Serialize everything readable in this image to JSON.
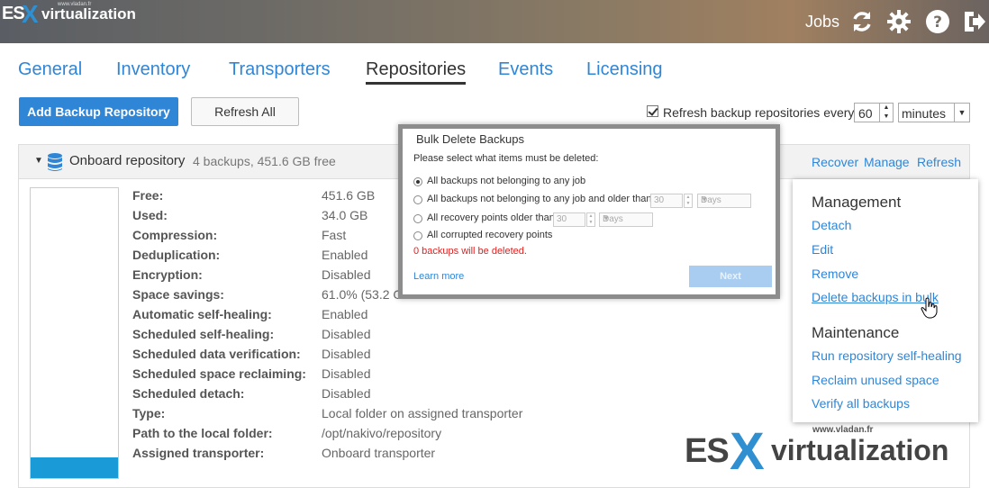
{
  "brand": {
    "es": "ES",
    "x": "X",
    "rest": "virtualization",
    "url": "www.vladan.fr"
  },
  "header": {
    "jobs": "Jobs"
  },
  "icons": {
    "refresh": "refresh-icon",
    "settings": "gear-icon",
    "help": "help-icon",
    "logout": "logout-icon"
  },
  "tabs": [
    {
      "label": "General"
    },
    {
      "label": "Inventory"
    },
    {
      "label": "Transporters"
    },
    {
      "label": "Repositories",
      "active": true
    },
    {
      "label": "Events"
    },
    {
      "label": "Licensing"
    }
  ],
  "toolbar": {
    "add": "Add Backup Repository",
    "refresh_all": "Refresh All",
    "auto_refresh_label": "Refresh backup repositories every",
    "auto_refresh_checked": true,
    "interval": "60",
    "unit": "minutes"
  },
  "repository": {
    "name": "Onboard repository",
    "summary": "4 backups, 451.6 GB free",
    "actions": {
      "recover": "Recover",
      "manage": "Manage",
      "refresh": "Refresh"
    },
    "used_fraction": 0.07,
    "properties": [
      {
        "label": "Free:",
        "value": "451.6 GB"
      },
      {
        "label": "Used:",
        "value": "34.0 GB"
      },
      {
        "label": "Compression:",
        "value": "Fast"
      },
      {
        "label": "Deduplication:",
        "value": "Enabled"
      },
      {
        "label": "Encryption:",
        "value": "Disabled"
      },
      {
        "label": "Space savings:",
        "value": "61.0% (53.2 G"
      },
      {
        "label": "Automatic self-healing:",
        "value": "Enabled"
      },
      {
        "label": "Scheduled self-healing:",
        "value": "Disabled"
      },
      {
        "label": "Scheduled data verification:",
        "value": "Disabled"
      },
      {
        "label": "Scheduled space reclaiming:",
        "value": "Disabled"
      },
      {
        "label": "Scheduled detach:",
        "value": "Disabled"
      },
      {
        "label": "Type:",
        "value": "Local folder on assigned transporter"
      },
      {
        "label": "Path to the local folder:",
        "value": "/opt/nakivo/repository"
      },
      {
        "label": "Assigned transporter:",
        "value": "Onboard transporter"
      }
    ]
  },
  "manage_menu": {
    "management_heading": "Management",
    "detach": "Detach",
    "edit": "Edit",
    "remove": "Remove",
    "delete_bulk": "Delete backups in bulk",
    "maintenance_heading": "Maintenance",
    "self_heal": "Run repository self-healing",
    "reclaim": "Reclaim unused space",
    "verify": "Verify all backups"
  },
  "bulk_delete": {
    "title": "Bulk Delete Backups",
    "prompt": "Please select what items must be deleted:",
    "options": [
      {
        "label": "All backups not belonging to any job",
        "selected": true
      },
      {
        "label": "All backups not belonging to any job and older than",
        "value": "30",
        "unit": "Days"
      },
      {
        "label": "All recovery points older than",
        "value": "30",
        "unit": "Days"
      },
      {
        "label": "All corrupted recovery points"
      }
    ],
    "warning": "0 backups will be deleted.",
    "learn_more": "Learn more",
    "next": "Next"
  }
}
